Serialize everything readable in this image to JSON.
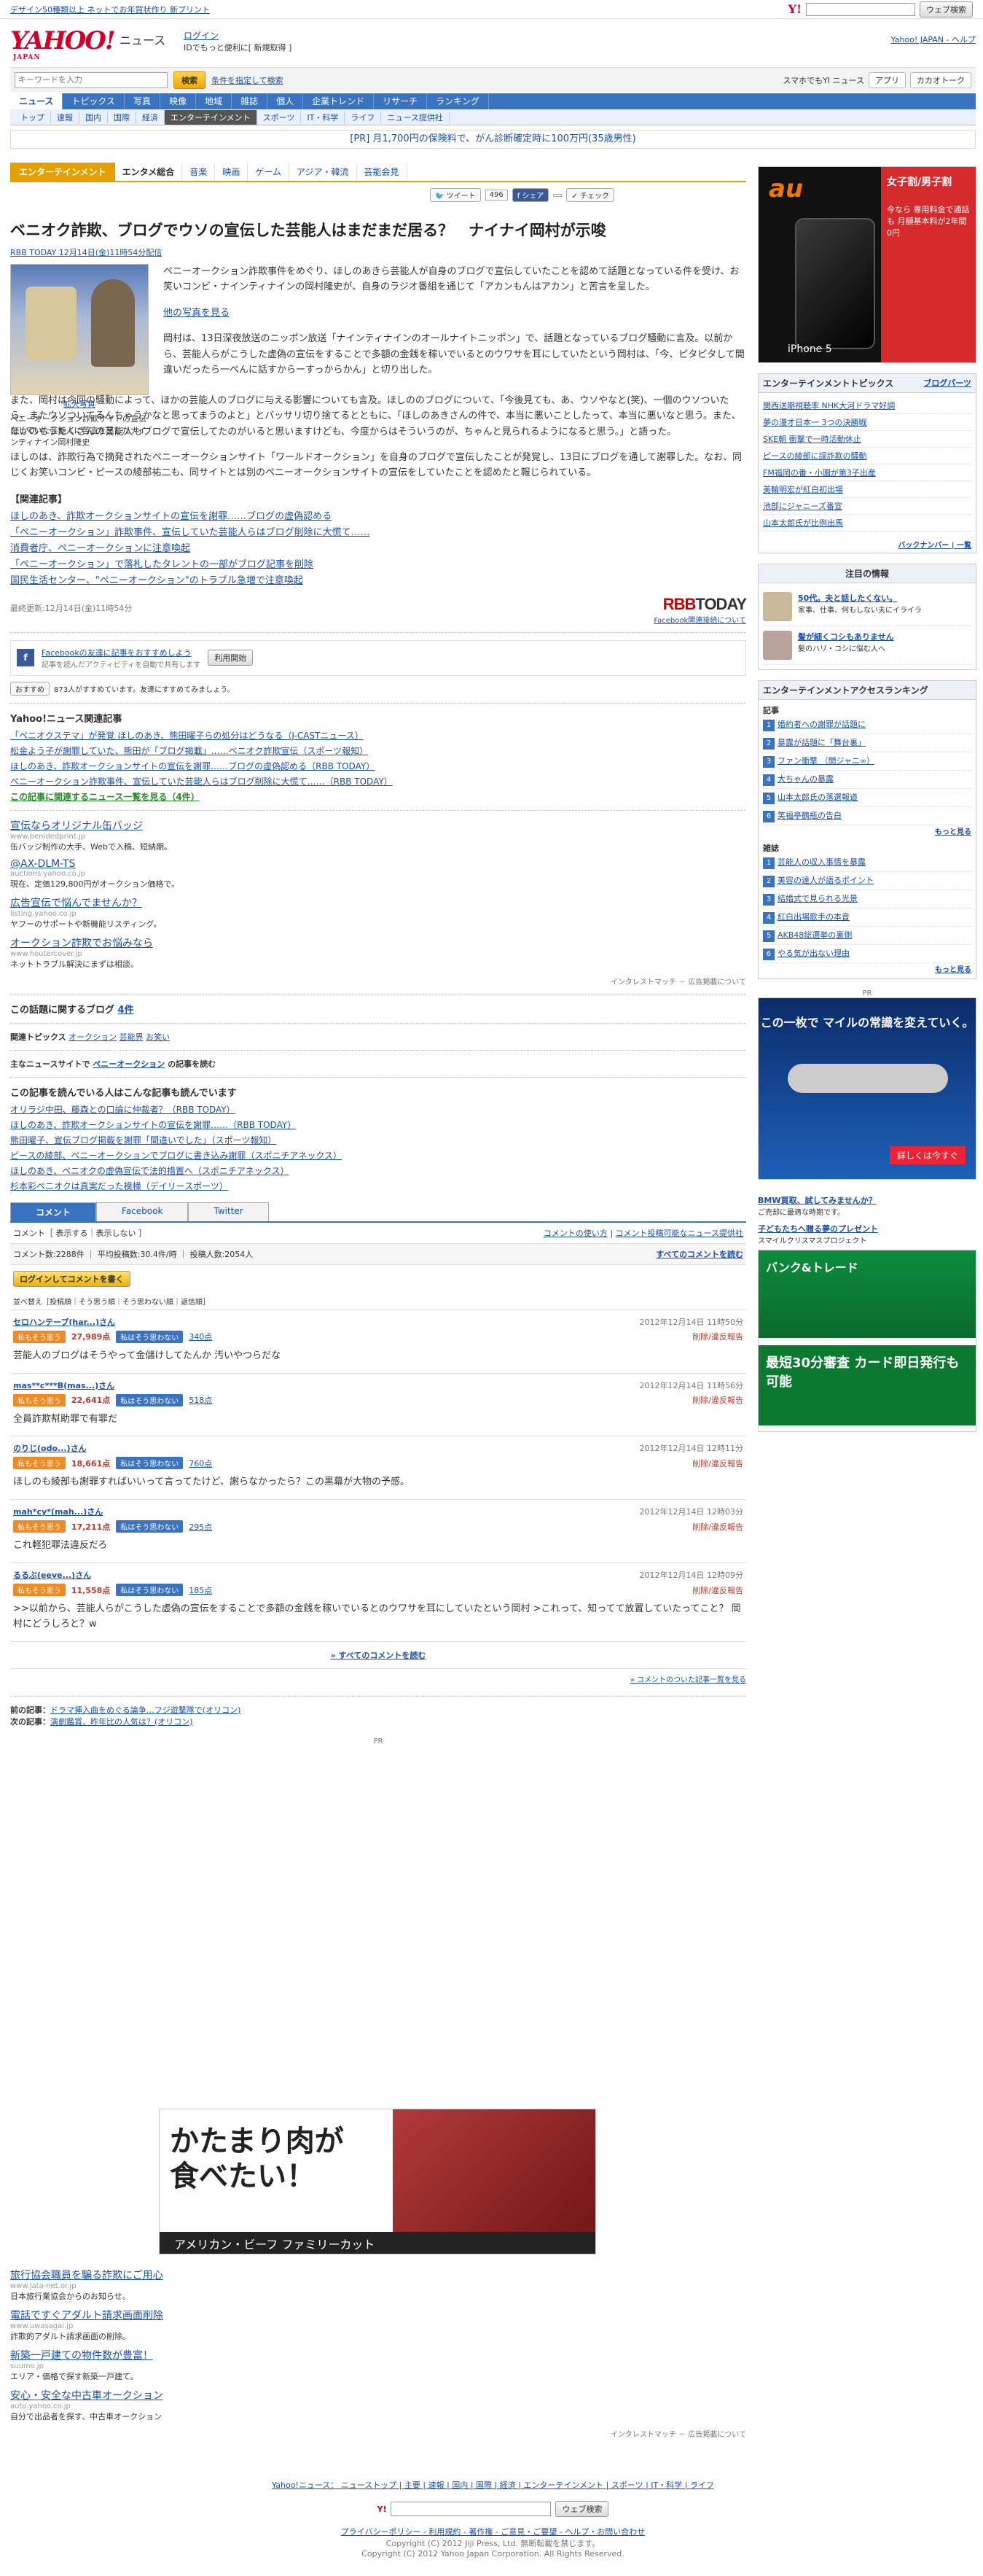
{
  "topstrip": {
    "notice": "デザイン50種類以上 ネットでお年賀状作り 新プリント",
    "search_button": "ウェブ検索",
    "yahoo_mark": "Y!"
  },
  "header": {
    "logo": "YAHOO!",
    "logo_sub": "JAPAN",
    "service": "ニュース",
    "login": "ログイン",
    "login_sub": "IDでもっと便利に[ 新規取得 ]",
    "top_link": "Yahoo! JAPAN - ヘルプ"
  },
  "search": {
    "placeholder": "キーワードを入力",
    "button": "検索",
    "cond": "条件を指定して検索",
    "right_label": "スマホでもYI ニュース",
    "app": "アプリ",
    "kakaku": "カカオトーク"
  },
  "mainnav": [
    "ニュース",
    "トピックス",
    "写真",
    "映像",
    "地域",
    "雑誌",
    "個人",
    "企業トレンド",
    "リサーチ",
    "ランキング"
  ],
  "subnav": [
    "トップ",
    "速報",
    "国内",
    "国際",
    "経済",
    "エンターテインメント",
    "スポーツ",
    "IT・科学",
    "ライフ",
    "ニュース提供社"
  ],
  "subnav_active_index": 5,
  "prbar": "[PR] 月1,700円の保険料で、がん診断確定時に100万円(35歳男性)",
  "cattabs": {
    "main": "エンターテインメント",
    "items": [
      "エンタメ総合",
      "音楽",
      "映画",
      "ゲーム",
      "アジア・韓流",
      "芸能会見"
    ]
  },
  "share": {
    "tweet": "ツイート",
    "tweet_count": "496",
    "fb": "シェア",
    "fb_count": "",
    "check": "チェック"
  },
  "article": {
    "title": "ベニオク詐欺、ブログでウソの宣伝した芸能人はまだまだ居る？　ナイナイ岡村が示唆",
    "meta": "RBB TODAY 12月14日(金)11時54分配信",
    "photo_caption": "ペニーオークション詐欺サイトの宣伝をしていた芸能人に苦言を呈したナインティナイン岡村隆史",
    "photo_zoom": "拡大写真",
    "p1": "ペニーオークション詐欺事件をめぐり、ほしのあきら芸能人が自身のブログで宣伝していたことを認めて話題となっている件を受け、お笑いコンビ・ナインティナインの岡村隆史が、自身のラジオ番組を通じて「アカンもんはアカン」と苦言を呈した。",
    "p1_link": "他の写真を見る",
    "p2": "岡村は、13日深夜放送のニッポン放送「ナインティナインのオールナイトニッポン」で、話題となっているブログ騒動に言及。以前から、芸能人らがこうした虚偽の宣伝をすることで多額の金銭を稼いでいるとのウワサを耳にしていたという岡村は、「今、ピタピタして間違いだったら一ぺんに話すからーすっからかん」と切り出した。",
    "p3": "また、岡村は今回の騒動によって、ほかの芸能人のブログに与える影響についても言及。ほしののブログについて、「今後見ても、あ、ウソやなと(笑)、一個のウソついたら、またウソついてるんちゃうかなと思ってまうのよと」とバッサリ切り捨てるとともに、「ほしのあきさんの件で、本当に悪いことしたって、本当に悪いなと思う。また、ほかのもうたくさんの芸能人もブログで宣伝してたのがいると思いますけども、今度からはそういうのが、ちゃんと見られるようになると思う。」と語った。",
    "p4": "ほしのは、詐欺行為で摘発されたペニーオークションサイト「ワールドオークション」を自身のブログで宣伝したことが発覚し、13日にブログを通して謝罪した。なお、同じくお笑いコンビ・ピースの綾部祐二も、同サイトとは別のペニーオークションサイトの宣伝をしていたことを認めたと報じられている。",
    "related_head": "【関連記事】",
    "related": [
      "ほしのあき、詐欺オークションサイトの宣伝を謝罪……ブログの虚偽認める",
      "「ペニーオークション」詐欺事件、宣伝していた芸能人らはブログ削除に大慌て……",
      "消費者庁、ペニーオークションに注意喚起",
      "「ペニーオークション」で落札したタレントの一部がブログ記事を削除",
      "国民生活センター、\"ペニーオークション\"のトラブル急増で注意喚起"
    ],
    "updated": "最終更新:12月14日(金)11時54分",
    "source_logo_r": "RBB",
    "source_logo_t": "TODAY",
    "fb_related": "Facebook関連接続について"
  },
  "fbconnect": {
    "title": "Facebookの友達に記事をおすすめしよう",
    "desc": "記事を読んだアクティビティを自動で共有します",
    "button": "利用開始"
  },
  "recommend": {
    "label": "おすすめ",
    "text": "873人がすすめています。友達にすすめてみましょう。"
  },
  "rel_news": {
    "head": "Yahoo!ニュース関連記事",
    "items": [
      "「ペニオクステマ」が発覚 ほしのあき、熊田曜子らの処分はどうなる（J-CASTニュース）",
      "松金よう子が謝罪していた、熊田が「ブログ掲載」……ペニオク詐欺宣伝（スポーツ報知）",
      "ほしのあき、詐欺オークションサイトの宣伝を謝罪……ブログの虚偽認める（RBB TODAY）",
      "ペニーオークション詐欺事件、宣伝していた芸能人らはブログ削除に大慌て……（RBB TODAY）"
    ],
    "more": "この記事に関連するニュース一覧を見る（4件）"
  },
  "ads": [
    {
      "title": "宣伝ならオリジナル缶バッジ",
      "url": "www.benidedprint.jp",
      "desc": "缶バッジ制作の大手、Webで入稿、短納期。"
    },
    {
      "title": "@AX-DLM-TS",
      "url": "auctions.yahoo.co.jp",
      "desc": "現在、定価129,800円がオークション価格で。"
    },
    {
      "title": "広告宣伝で悩んでませんか？",
      "url": "listing.yahoo.co.jp",
      "desc": "ヤフーのサポートや新機能リスティング。"
    },
    {
      "title": "オークション詐欺でお悩みなら",
      "url": "www.houtercover.jp",
      "desc": "ネットトラブル解決にまずは相談。"
    }
  ],
  "ads_footer": "インタレストマッチ － 広告掲載について",
  "blog": {
    "head": "この話題に関するブログ",
    "count": "4件"
  },
  "topics": {
    "label": "関連トピックス",
    "items": [
      "オークション",
      "芸能界",
      "お笑い"
    ]
  },
  "mainsite": {
    "label": "主なニュースサイトで",
    "keyword": "ペニーオークション",
    "suffix": "の記事を読む"
  },
  "ranking_rel": {
    "head": "この記事を読んでいる人はこんな記事も読んでいます",
    "items": [
      "オリラジ中田、藤森との口論に仲裁者？（RBB TODAY）",
      "ほしのあき、詐欺オークションサイトの宣伝を謝罪……（RBB TODAY）",
      "熊田曜子、宣伝ブログ掲載を謝罪「間違いでした」（スポーツ報知）",
      "ピースの綾部、ペニーオークションでブログに書き込み謝罪（スポニチアネックス）",
      "ほしのあき、ペニオクの虚偽宣伝で法的措置へ（スポニチアネックス）",
      "杉本彩ペニオクは真実だった模様（デイリースポーツ）"
    ]
  },
  "comment_tabs": [
    "コメント",
    "Facebook",
    "Twitter"
  ],
  "comments_bar": {
    "show": "コメント［ 表示する｜表示しない ］",
    "policy": "コメントの使い方",
    "policy2": "コメント投稿可能なニュース提供社"
  },
  "comments_stats": {
    "text": "コメント数:2288件 ｜ 平均投稿数:30.4件/時 ｜ 投稿人数:2054人",
    "all": "すべてのコメントを読む"
  },
  "login_btn": "ログインしてコメントを書く",
  "sort": "並べ替え［投稿順｜そう思う順｜そう思わない順｜返信順］",
  "comments": [
    {
      "user": "セロハンテープ(har...)さん",
      "date": "2012年12月14日 11時50分",
      "good": "27,989点",
      "bad": "340点",
      "text": "芸能人のブログはそうやって金儲けしてたんか 汚いやつらだな"
    },
    {
      "user": "mas**c***B(mas...)さん",
      "date": "2012年12月14日 11時56分",
      "good": "22,641点",
      "bad": "518点",
      "text": "全員詐欺幇助罪で有罪だ"
    },
    {
      "user": "のりじ(odo...)さん",
      "date": "2012年12月14日 12時11分",
      "good": "18,661点",
      "bad": "760点",
      "text": "ほしのも綾部も謝罪すればいいって言ってたけど、謝らなかったら？この黒幕が大物の予感。"
    },
    {
      "user": "mah*cy*(mah...)さん",
      "date": "2012年12月14日 12時03分",
      "good": "17,211点",
      "bad": "295点",
      "text": "これ軽犯罪法違反だろ"
    },
    {
      "user": "るるぶ(eeve...)さん",
      "date": "2012年12月14日 12時09分",
      "good": "11,558点",
      "bad": "185点",
      "text": ">>以前から、芸能人らがこうした虚偽の宣伝をすることで多額の金銭を稼いでいるとのウワサを耳にしていたという岡村 >これって、知ってて放置していたってこと？ 岡村にどうしろと？w"
    }
  ],
  "comment_labels": {
    "good": "私もそう思う",
    "bad": "私はそう思わない",
    "report": "削除/違反報告"
  },
  "all_comments": "» すべてのコメントを読む",
  "comments_rel": "» コメントのついた記事一覧を見る",
  "prevnext": {
    "prev_label": "前の記事：",
    "prev": "ドラマ挿入曲をめぐる論争…フジ遊撃隊で(オリコン)",
    "next_label": "次の記事：",
    "next": "演劇鑑賞、昨年比の人気は？(オリコン)"
  },
  "pr_label": "PR",
  "bigad": {
    "title1": "かたまり肉が",
    "title2": "食べたい！",
    "band": "アメリカン・ビーフ ファミリーカット"
  },
  "ads2": [
    {
      "title": "旅行協会職員を騙る詐欺にご用心",
      "url": "www.jata-net.or.jp",
      "desc": "日本旅行業協会からのお知らせ。"
    },
    {
      "title": "電話ですぐアダルト請求画面削除",
      "url": "www.uwasagai.jp",
      "desc": "詐欺的アダルト請求画面の削除。"
    },
    {
      "title": "新築一戸建ての物件数が豊富！",
      "url": "suumo.jp",
      "desc": "エリア・価格で探す新築一戸建て。"
    },
    {
      "title": "安心・安全な中古車オークション",
      "url": "auto.yahoo.co.jp",
      "desc": "自分で出品者を探す、中古車オークション"
    }
  ],
  "ads2_footer": "インタレストマッチ － 広告掲載について",
  "footer": {
    "links": "Yahoo!ニュース： ニューストップ | 主要 | 速報 | 国内 | 国際 | 経済 | エンターテインメント | スポーツ | IT・科学 | ライフ",
    "search_button": "ウェブ検索",
    "policy": "プライバシーポリシー - 利用規約 - 著作権 - ご意見・ご要望 - ヘルプ・お問い合わせ",
    "copy1": "Copyright (C) 2012 Jiji Press, Ltd. 無断転載を禁じます。",
    "copy2": "Copyright (C) 2012 Yahoo Japan Corporation. All Rights Reserved."
  },
  "right": {
    "au_logo": "au",
    "au_headline": "女子割/男子割",
    "au_sub": "今なら 専用料金で通話も 月額基本料が2年間0円",
    "iphone": "iPhone 5",
    "topics_head": "エンターテインメントトピックス",
    "topics_link": "ブログパーツ",
    "topics": [
      "関西送期視聴率 NHK大河ドラマ好調",
      "夢の漫才日本一 3つの決勝戦",
      "SKE朝 衝撃で一時活動休止",
      "ピースの綾部に誤詐欺の騒動",
      "FM福岡の番・小園が第3子出産",
      "美輪明宏が紅白初出場",
      "池部にジャニーズ番宣",
      "山本太郎氏が比例出馬"
    ],
    "topics_more": "バックナンバー | 一覧",
    "attention_head": "注目の情報",
    "attention": [
      {
        "t": "50代。夫と話したくない。",
        "d": "家事、仕事、何もしない夫にイライラ"
      },
      {
        "t": "髪が細くコシもありません",
        "d": "髪のハリ・コシに悩む人へ"
      }
    ],
    "ranking_head": "エンターテインメントアクセスランキング",
    "ranking_sub": "記事",
    "ranking": [
      "婚約者への謝罪が話題に",
      "暴露が話題に「舞台裏」",
      "ファン衝撃 （関ジャニ∞）",
      "大ちゃんの暴露",
      "山本太郎氏の落選報道",
      "笑福亭鶴瓶の告白"
    ],
    "ranking_more": "もっと見る",
    "mag_head": "雑誌",
    "mag": [
      "芸能人の収入事情を暴露",
      "美容の達人が語るポイント",
      "結婚式で見られる光景",
      "紅白出場歌手の本音",
      "AKB48総選挙の裏側",
      "やる気が出ない理由"
    ],
    "mag_more": "もっと見る",
    "pr_label": "PR",
    "plane_title": "この一枚で マイルの常識を変えていく。",
    "plane_cta": "詳しくは今すぐ",
    "smbc_title": "バンク&トレード",
    "smbc_sub": "最短30分審査 カード即日発行も可能",
    "bmw": "BMW買取、試してみませんか？",
    "bmw_desc": "ご売却に最適な時期です。",
    "kids": "子どもたちへ贈る夢のプレゼント",
    "kids_desc": "スマイルクリスマスプロジェクト"
  }
}
